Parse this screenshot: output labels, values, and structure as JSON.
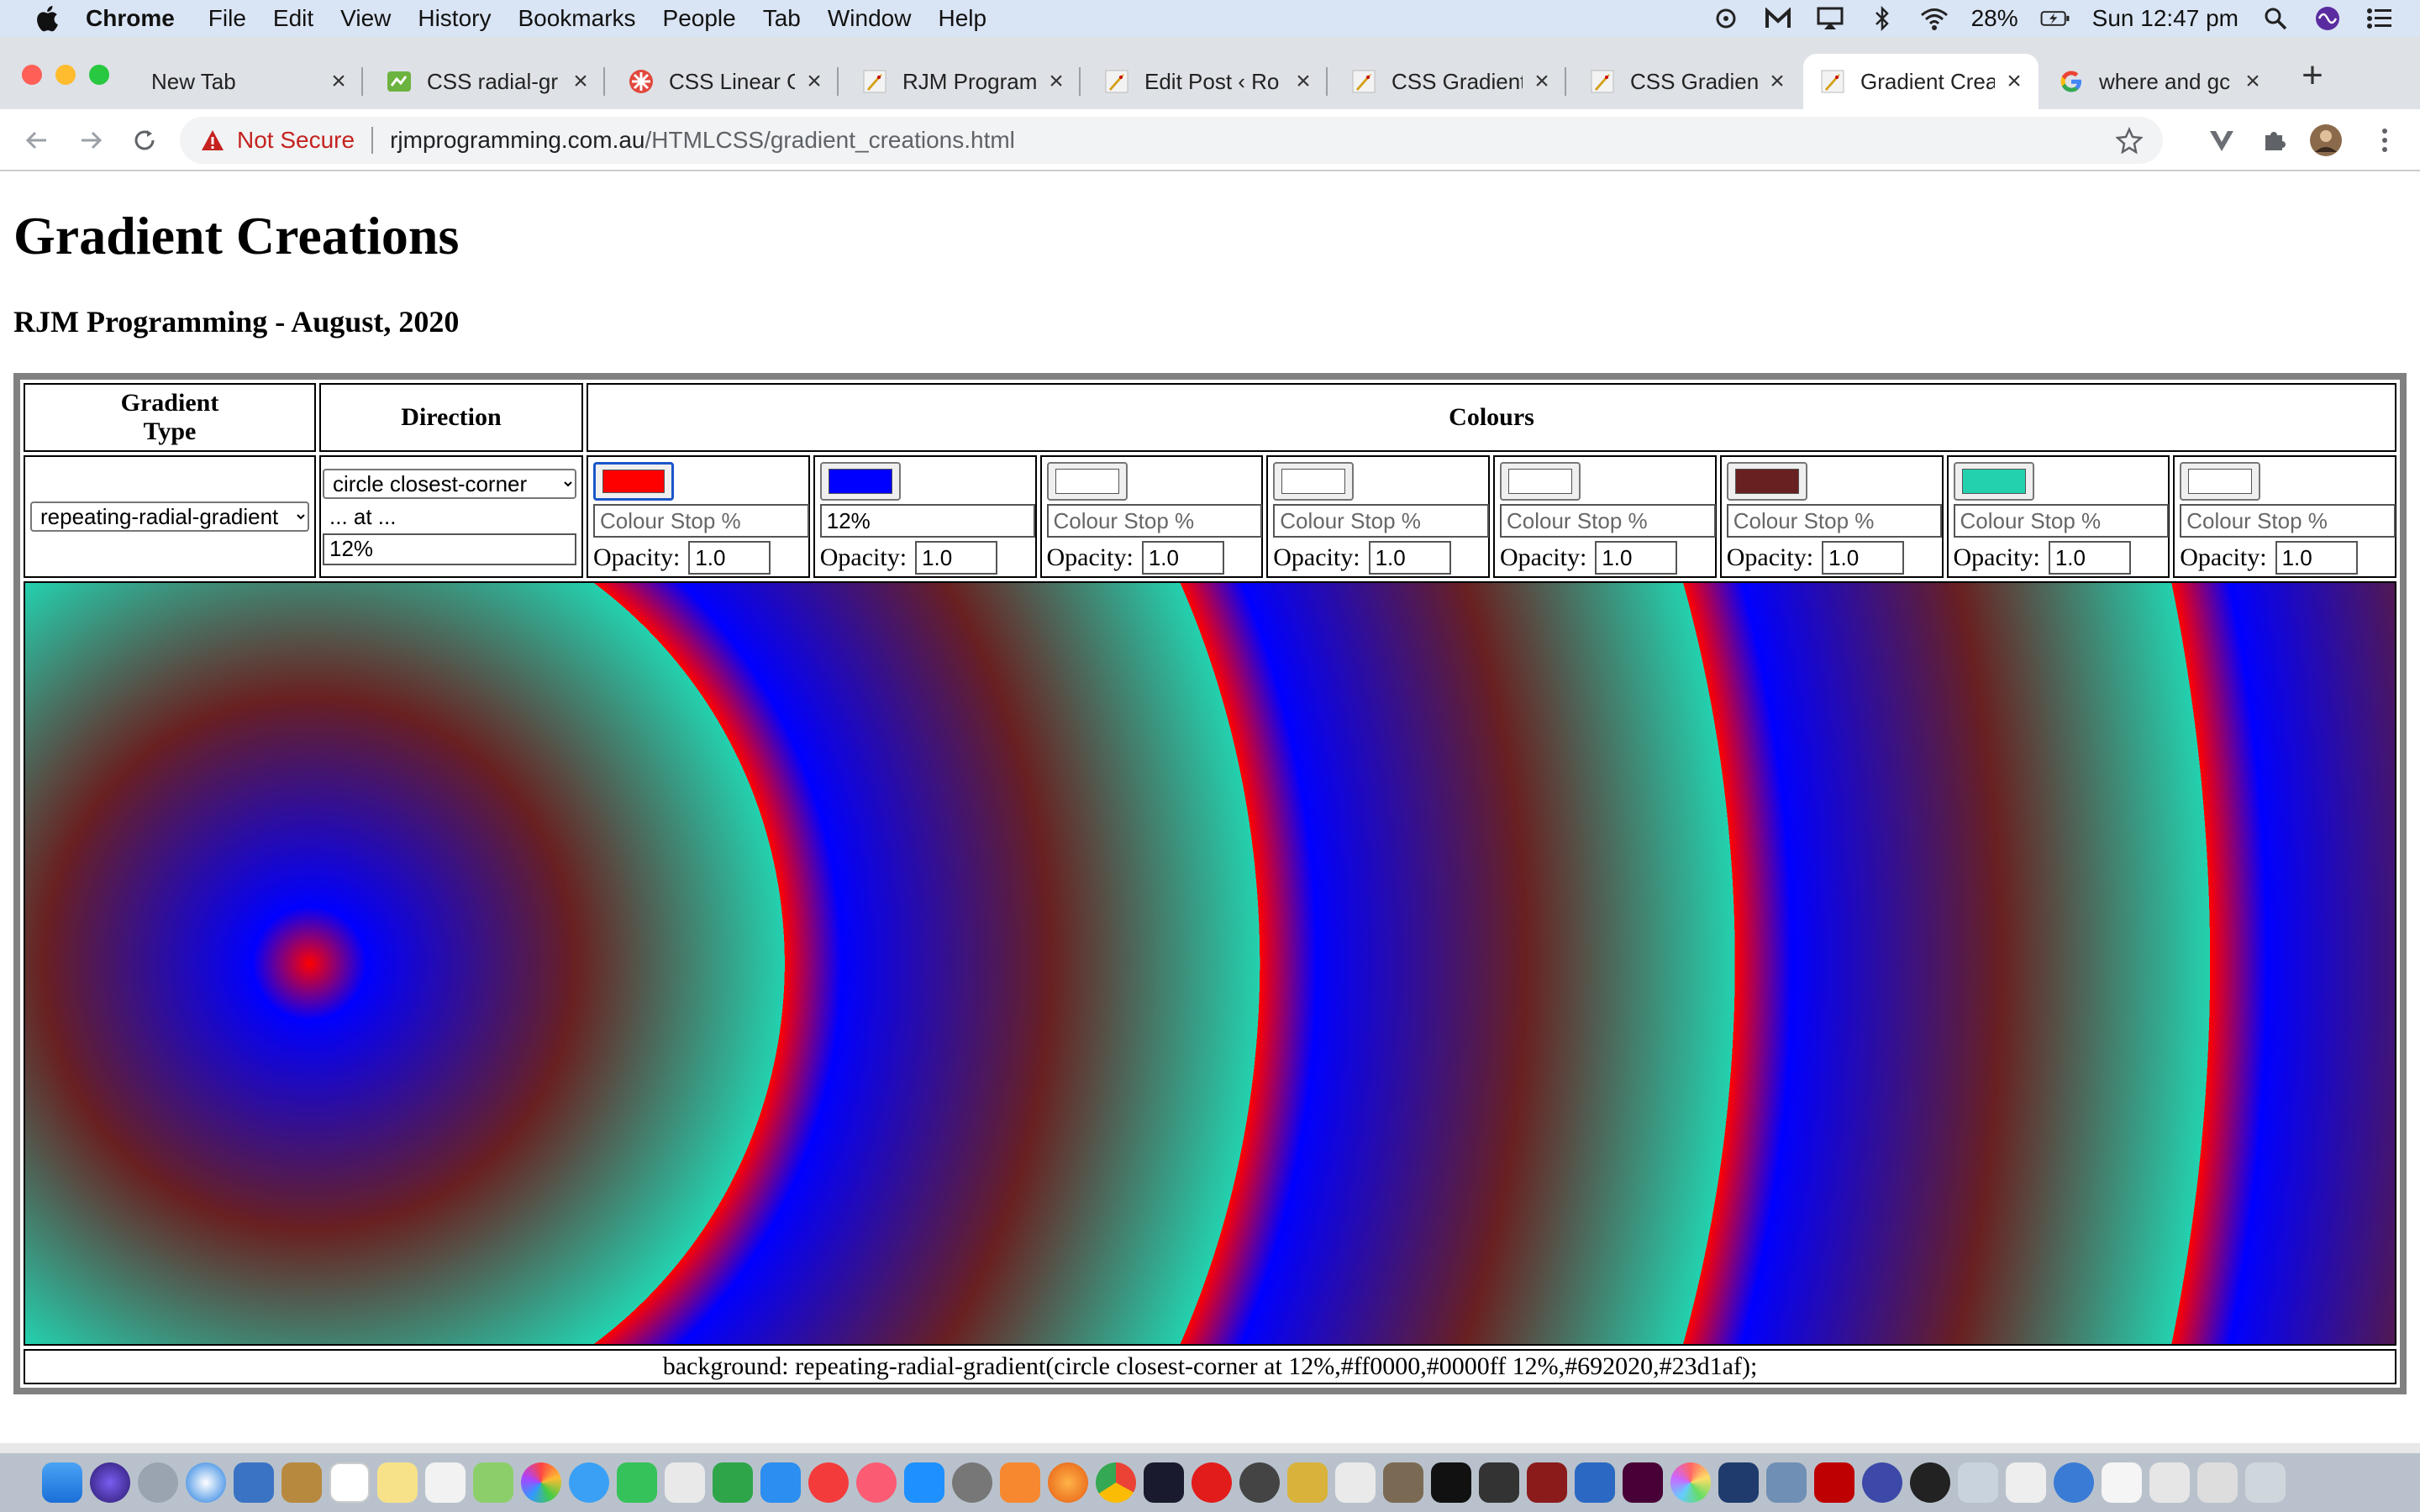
{
  "menubar": {
    "app_name": "Chrome",
    "items": [
      "File",
      "Edit",
      "View",
      "History",
      "Bookmarks",
      "People",
      "Tab",
      "Window",
      "Help"
    ],
    "battery": "28%",
    "clock": "Sun 12:47 pm"
  },
  "tabs": [
    {
      "title": "New Tab",
      "icon": "none"
    },
    {
      "title": "CSS radial-gr",
      "icon": "green-favicon"
    },
    {
      "title": "CSS Linear Gr",
      "icon": "red-flower-favicon"
    },
    {
      "title": "RJM Program",
      "icon": "rocket-favicon"
    },
    {
      "title": "Edit Post ‹ Ro",
      "icon": "rocket-favicon"
    },
    {
      "title": "CSS Gradient",
      "icon": "rocket-favicon"
    },
    {
      "title": "CSS Gradient",
      "icon": "rocket-favicon"
    },
    {
      "title": "Gradient Crea",
      "icon": "rocket-favicon",
      "active": true
    },
    {
      "title": "where and gc",
      "icon": "google-favicon"
    }
  ],
  "address_bar": {
    "security": "Not Secure",
    "host": "rjmprogramming.com.au",
    "path": "/HTMLCSS/gradient_creations.html"
  },
  "page": {
    "title": "Gradient Creations",
    "subtitle": "RJM Programming - August, 2020"
  },
  "table": {
    "headers": {
      "type_line1": "Gradient",
      "type_line2": "Type",
      "direction": "Direction",
      "colours": "Colours"
    },
    "gradient_type": "repeating-radial-gradient",
    "direction": "circle closest-corner",
    "at_label": "... at ...",
    "at_value": "12%",
    "stop_placeholder": "Colour Stop %",
    "opacity_label": "Opacity:",
    "colour_stops": [
      {
        "color": "#ff0000",
        "stop": "",
        "opacity": "1.0",
        "focused": true
      },
      {
        "color": "#0000ff",
        "stop": "12%",
        "opacity": "1.0"
      },
      {
        "color": "#ffffff",
        "stop": "",
        "opacity": "1.0"
      },
      {
        "color": "#ffffff",
        "stop": "",
        "opacity": "1.0"
      },
      {
        "color": "#ffffff",
        "stop": "",
        "opacity": "1.0"
      },
      {
        "color": "#692020",
        "stop": "",
        "opacity": "1.0"
      },
      {
        "color": "#23d1af",
        "stop": "",
        "opacity": "1.0"
      },
      {
        "color": "#ffffff",
        "stop": "",
        "opacity": "1.0"
      }
    ],
    "css_output": "background: repeating-radial-gradient(circle closest-corner at 12%,#ff0000,#0000ff 12%,#692020,#23d1af);"
  },
  "colors": {
    "menubar_bg": "#d9e4f4",
    "tabstrip_bg": "#dee1e6",
    "not_secure_red": "#c5221f",
    "table_border": "#808080"
  }
}
